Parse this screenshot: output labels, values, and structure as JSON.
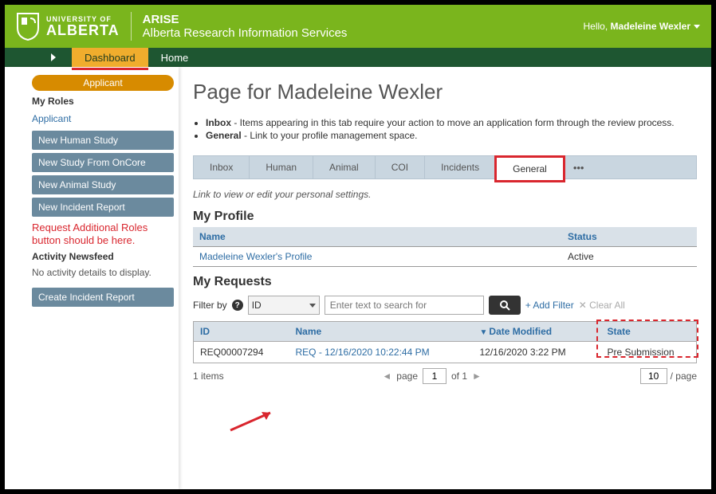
{
  "header": {
    "univ_top": "UNIVERSITY OF",
    "univ_name": "ALBERTA",
    "arise_title": "ARISE",
    "arise_sub": "Alberta Research Information Services",
    "hello_prefix": "Hello, ",
    "hello_name": "Madeleine Wexler"
  },
  "nav": {
    "dashboard": "Dashboard",
    "home": "Home"
  },
  "sidebar": {
    "role_banner": "Applicant",
    "my_roles": "My Roles",
    "applicant_link": "Applicant",
    "buttons": [
      "New Human Study",
      "New Study From OnCore",
      "New Animal Study",
      "New Incident Report"
    ],
    "red_note": "Request Additional Roles button should be here.",
    "activity_head": "Activity Newsfeed",
    "no_activity": "No activity details to display.",
    "create_incident": "Create Incident Report"
  },
  "content": {
    "page_title": "Page for Madeleine Wexler",
    "desc_inbox_b": "Inbox",
    "desc_inbox_t": " - Items appearing in this tab require your action to move an application form through the review process.",
    "desc_general_b": "General",
    "desc_general_t": " - Link to your profile management space.",
    "tabs": [
      "Inbox",
      "Human",
      "Animal",
      "COI",
      "Incidents",
      "General"
    ],
    "link_hint": "Link to view or edit your personal settings.",
    "my_profile": "My Profile",
    "profile_cols": {
      "name": "Name",
      "status": "Status"
    },
    "profile_row": {
      "name": "Madeleine Wexler's Profile",
      "status": "Active"
    },
    "my_requests": "My Requests",
    "filter_label": "Filter by",
    "filter_field": "ID",
    "filter_placeholder": "Enter text to search for",
    "add_filter": "+ Add Filter",
    "clear_all_x": "✕",
    "clear_all": " Clear All",
    "req_cols": {
      "id": "ID",
      "name": "Name",
      "date": "Date Modified",
      "state": "State"
    },
    "req_row": {
      "id": "REQ00007294",
      "name": "REQ - 12/16/2020 10:22:44 PM",
      "date": "12/16/2020 3:22 PM",
      "state": "Pre Submission"
    },
    "pager": {
      "items": "1 items",
      "page_lbl": "page",
      "page_val": "1",
      "of": "of 1",
      "per_val": "10",
      "per_lbl": "/ page"
    }
  }
}
